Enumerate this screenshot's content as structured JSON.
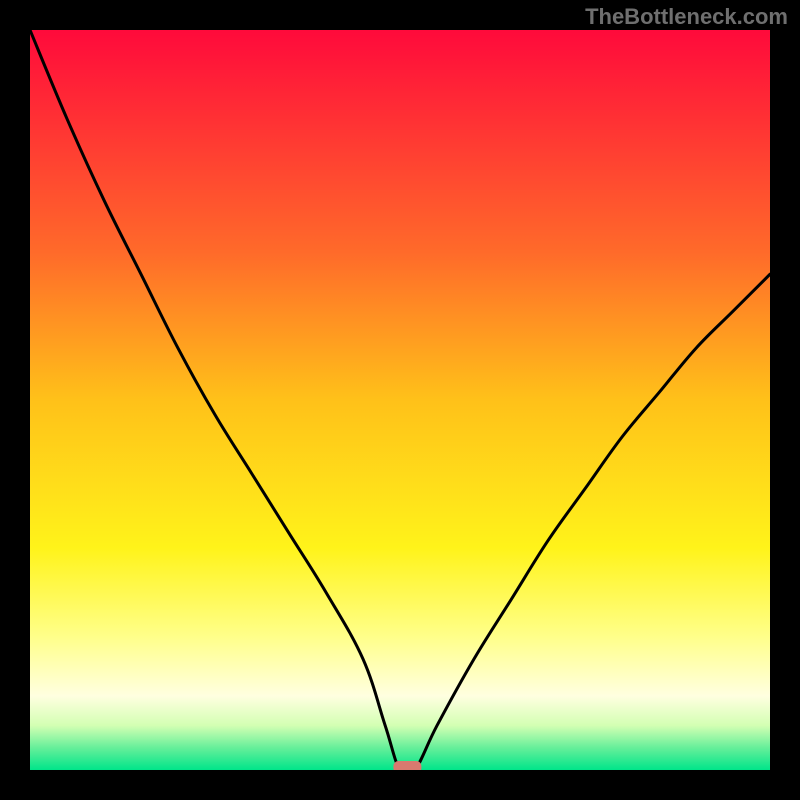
{
  "watermark": "TheBottleneck.com",
  "chart_data": {
    "type": "line",
    "title": "",
    "xlabel": "",
    "ylabel": "",
    "xlim": [
      0,
      100
    ],
    "ylim": [
      0,
      100
    ],
    "grid": false,
    "legend": false,
    "series": [
      {
        "name": "bottleneck-curve",
        "x": [
          0,
          5,
          10,
          15,
          20,
          25,
          30,
          35,
          40,
          45,
          48,
          50,
          52,
          55,
          60,
          65,
          70,
          75,
          80,
          85,
          90,
          95,
          100
        ],
        "values": [
          100,
          88,
          77,
          67,
          57,
          48,
          40,
          32,
          24,
          15,
          6,
          0,
          0,
          6,
          15,
          23,
          31,
          38,
          45,
          51,
          57,
          62,
          67
        ]
      }
    ],
    "marker": {
      "x": 51,
      "y": 0,
      "color": "#d87a6f"
    },
    "gradient_stops": [
      {
        "offset": 0.0,
        "color": "#ff0a3b"
      },
      {
        "offset": 0.3,
        "color": "#ff6a2a"
      },
      {
        "offset": 0.5,
        "color": "#ffc119"
      },
      {
        "offset": 0.7,
        "color": "#fff31a"
      },
      {
        "offset": 0.82,
        "color": "#ffff8a"
      },
      {
        "offset": 0.9,
        "color": "#ffffe0"
      },
      {
        "offset": 0.94,
        "color": "#d3ffb3"
      },
      {
        "offset": 0.97,
        "color": "#66ef9a"
      },
      {
        "offset": 1.0,
        "color": "#00e58a"
      }
    ]
  }
}
